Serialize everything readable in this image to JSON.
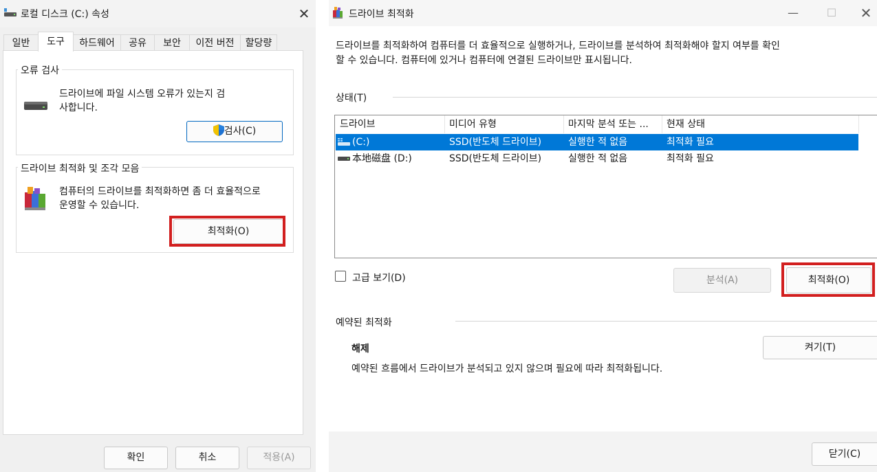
{
  "left_window": {
    "title": "로컬 디스크 (C:) 속성",
    "close_glyph": "✕",
    "tabs": [
      {
        "label": "일반",
        "active": false
      },
      {
        "label": "도구",
        "active": true
      },
      {
        "label": "하드웨어",
        "active": false
      },
      {
        "label": "공유",
        "active": false
      },
      {
        "label": "보안",
        "active": false
      },
      {
        "label": "이전 버전",
        "active": false
      },
      {
        "label": "할당량",
        "active": false
      }
    ],
    "error_check": {
      "group_label": "오류 검사",
      "description_line1": "드라이브에 파일 시스템 오류가 있는지 검",
      "description_line2": "사합니다.",
      "button_label": "검사(C)"
    },
    "optimize": {
      "group_label": "드라이브 최적화 및 조각 모음",
      "description_line1": "컴퓨터의 드라이브를 최적화하면 좀 더 효율적으로",
      "description_line2": "운영할 수 있습니다.",
      "button_label": "최적화(O)"
    },
    "buttons": {
      "ok": "확인",
      "cancel": "취소",
      "apply": "적용(A)"
    }
  },
  "right_window": {
    "title": "드라이브 최적화",
    "controls": {
      "minimize": "—",
      "maximize": "☐",
      "close": "✕"
    },
    "intro_line1": "드라이브를 최적화하여 컴퓨터를 더 효율적으로 실행하거나, 드라이브를 분석하여 최적화해야 할지 여부를 확인",
    "intro_line2": "할 수 있습니다. 컴퓨터에 있거나 컴퓨터에 연결된 드라이브만 표시됩니다.",
    "status_label": "상태(T)",
    "columns": [
      "드라이브",
      "미디어 유형",
      "마지막 분석 또는 ...",
      "현재 상태"
    ],
    "drives": [
      {
        "name": "(C:)",
        "media": "SSD(반도체 드라이브)",
        "last": "실행한 적 없음",
        "status": "최적화 필요",
        "selected": true
      },
      {
        "name": "本地磁盘 (D:)",
        "media": "SSD(반도체 드라이브)",
        "last": "실행한 적 없음",
        "status": "최적화 필요",
        "selected": false
      }
    ],
    "advanced_view_label": "고급 보기(D)",
    "analyze_label": "분석(A)",
    "optimize_label": "최적화(O)",
    "scheduled_label": "예약된 최적화",
    "schedule_state": "해제",
    "schedule_desc": "예약된 흐름에서 드라이브가 분석되고 있지 않으며 필요에 따라 최적화됩니다.",
    "turn_on_label": "켜기(T)",
    "close_label": "닫기(C)"
  },
  "colors": {
    "selection": "#0078d7",
    "highlight_box": "#d21f1f",
    "focus_border": "#0067c0"
  }
}
